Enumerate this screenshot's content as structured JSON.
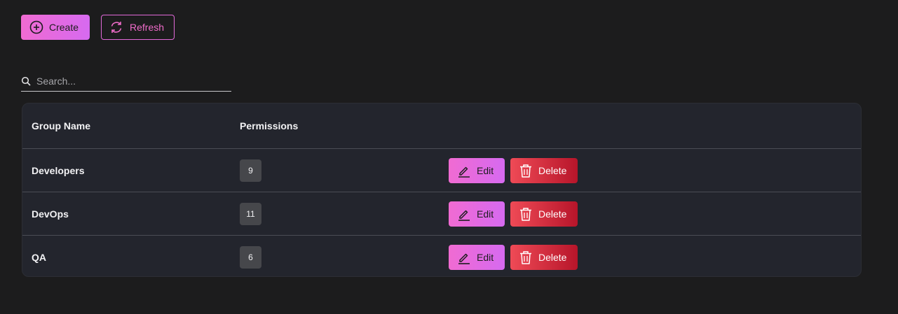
{
  "toolbar": {
    "create_label": "Create",
    "refresh_label": "Refresh"
  },
  "search": {
    "placeholder": "Search..."
  },
  "table": {
    "headers": {
      "group_name": "Group Name",
      "permissions": "Permissions"
    },
    "rows": [
      {
        "name": "Developers",
        "permissions": "9",
        "edit_label": "Edit",
        "delete_label": "Delete"
      },
      {
        "name": "DevOps",
        "permissions": "11",
        "edit_label": "Edit",
        "delete_label": "Delete"
      },
      {
        "name": "QA",
        "permissions": "6",
        "edit_label": "Edit",
        "delete_label": "Delete"
      }
    ]
  },
  "icons": {
    "create": "plus-circle-icon",
    "refresh": "refresh-icon",
    "search": "search-icon",
    "edit": "pencil-icon",
    "delete": "trash-icon"
  },
  "colors": {
    "accent_pink": "#f06bd2",
    "accent_purple": "#d66af0",
    "danger": "#ef4a56",
    "danger_dark": "#b7152a"
  }
}
